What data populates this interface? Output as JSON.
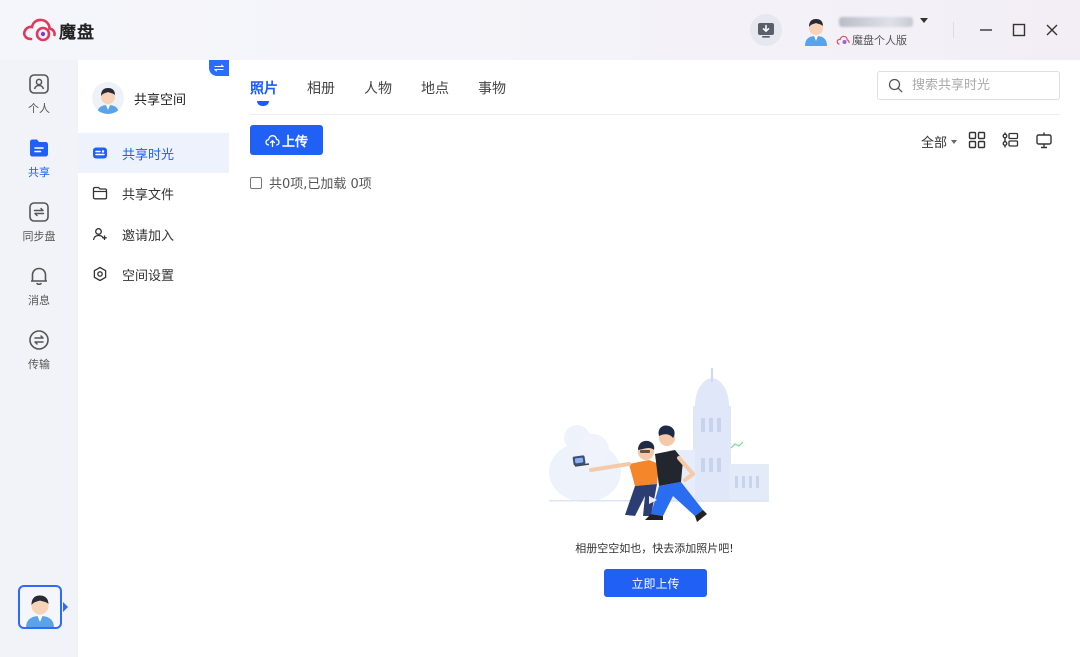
{
  "app": {
    "name": "魔盘",
    "plan_label": "魔盘个人版",
    "accent_color": "#2060f5"
  },
  "window_controls": [
    "minimize-icon",
    "maximize-icon",
    "close-icon"
  ],
  "rail": {
    "items": [
      {
        "label": "个人",
        "icon": "person-icon"
      },
      {
        "label": "共享",
        "icon": "share-icon"
      },
      {
        "label": "同步盘",
        "icon": "sync-icon"
      },
      {
        "label": "消息",
        "icon": "bell-icon"
      },
      {
        "label": "传输",
        "icon": "transfer-icon"
      }
    ],
    "active": "共享"
  },
  "space": {
    "name": "共享空间",
    "menu": [
      {
        "label": "共享时光",
        "icon": "timeline-icon"
      },
      {
        "label": "共享文件",
        "icon": "folder-icon"
      },
      {
        "label": "邀请加入",
        "icon": "invite-icon"
      },
      {
        "label": "空间设置",
        "icon": "settings-icon"
      }
    ],
    "active": "共享时光"
  },
  "main": {
    "tabs": [
      "照片",
      "相册",
      "人物",
      "地点",
      "事物"
    ],
    "active_tab": "照片",
    "search_placeholder": "搜索共享时光",
    "upload_label": "上传",
    "filter_label": "全部",
    "count_text": "共0项,已加载 0项",
    "empty_text": "相册空空如也，快去添加照片吧!",
    "cta_label": "立即上传"
  }
}
